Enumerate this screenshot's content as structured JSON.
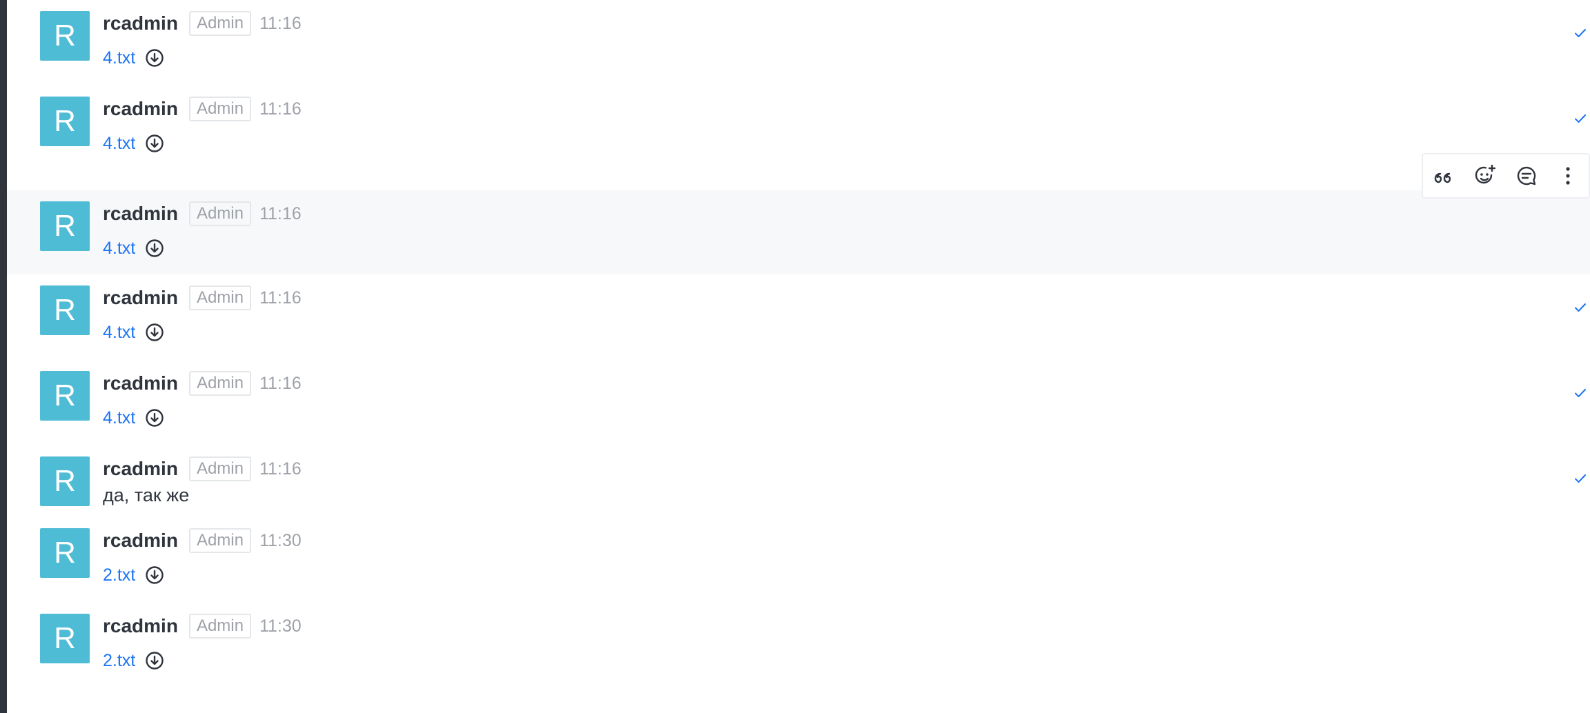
{
  "messages": [
    {
      "username": "rcadmin",
      "role": "Admin",
      "time": "11:16",
      "avatar_letter": "R",
      "file": "4.txt",
      "read": true
    },
    {
      "username": "rcadmin",
      "role": "Admin",
      "time": "11:16",
      "avatar_letter": "R",
      "file": "4.txt",
      "read": true
    },
    {
      "username": "rcadmin",
      "role": "Admin",
      "time": "11:16",
      "avatar_letter": "R",
      "file": "4.txt",
      "read": false
    },
    {
      "username": "rcadmin",
      "role": "Admin",
      "time": "11:16",
      "avatar_letter": "R",
      "file": "4.txt",
      "read": true
    },
    {
      "username": "rcadmin",
      "role": "Admin",
      "time": "11:16",
      "avatar_letter": "R",
      "file": "4.txt",
      "read": true
    },
    {
      "username": "rcadmin",
      "role": "Admin",
      "time": "11:16",
      "avatar_letter": "R",
      "text": "да, так же",
      "read": true
    },
    {
      "username": "rcadmin",
      "role": "Admin",
      "time": "11:30",
      "avatar_letter": "R",
      "file": "2.txt",
      "read": false
    },
    {
      "username": "rcadmin",
      "role": "Admin",
      "time": "11:30",
      "avatar_letter": "R",
      "file": "2.txt",
      "read": false
    }
  ],
  "toolbar": {
    "actions": [
      "quote-icon",
      "add-reaction-icon",
      "reply-in-thread-icon",
      "more-options-icon"
    ]
  },
  "colors": {
    "avatar": "#4fbcd6",
    "link": "#1d74f5",
    "hover_bg": "#f7f8fa",
    "check": "#1d74f5"
  }
}
